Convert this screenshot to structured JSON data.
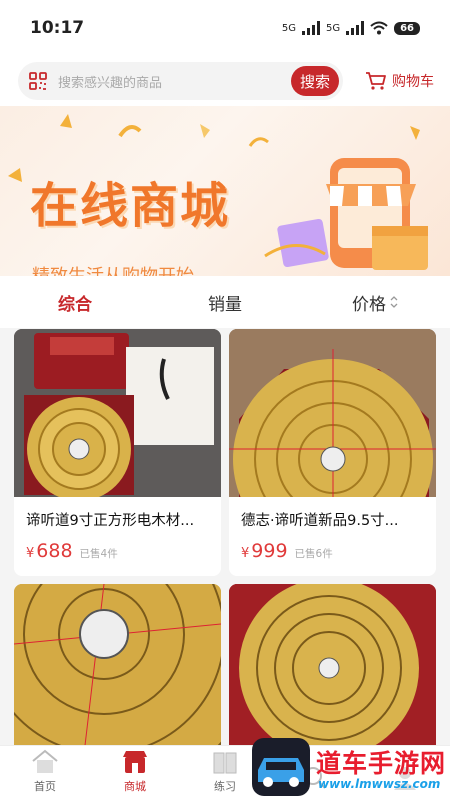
{
  "status_bar": {
    "time": "10:17",
    "net1": "5G",
    "net2": "5G",
    "battery": "66"
  },
  "search": {
    "placeholder": "搜索感兴趣的商品",
    "button": "搜索"
  },
  "cart": {
    "label": "购物车"
  },
  "banner": {
    "title": "在线商城",
    "subtitle": "精致生活从购物开始"
  },
  "sort_tabs": [
    {
      "label": "综合",
      "active": true
    },
    {
      "label": "销量",
      "active": false
    },
    {
      "label": "价格",
      "active": false
    }
  ],
  "products": [
    {
      "title": "谛听道9寸正方形电木材...",
      "currency": "¥",
      "price": "688",
      "sold": "已售4件"
    },
    {
      "title": "德志·谛听道新品9.5寸...",
      "currency": "¥",
      "price": "999",
      "sold": "已售6件"
    },
    {
      "title": "",
      "currency": "",
      "price": "",
      "sold": ""
    },
    {
      "title": "",
      "currency": "",
      "price": "",
      "sold": ""
    }
  ],
  "tabbar": [
    {
      "label": "首页",
      "icon": "home-icon",
      "active": false
    },
    {
      "label": "商城",
      "icon": "shop-icon",
      "active": true
    },
    {
      "label": "练习",
      "icon": "book-icon",
      "active": false
    },
    {
      "label": "",
      "icon": "search-icon",
      "active": false
    },
    {
      "label": "",
      "icon": "user-icon",
      "active": false
    }
  ],
  "watermark": {
    "text": "道车手游网",
    "url": "www.lmwwsz.com"
  },
  "colors": {
    "accent": "#c7282b",
    "price": "#e03a3a",
    "banner_title": "#f0772b"
  }
}
